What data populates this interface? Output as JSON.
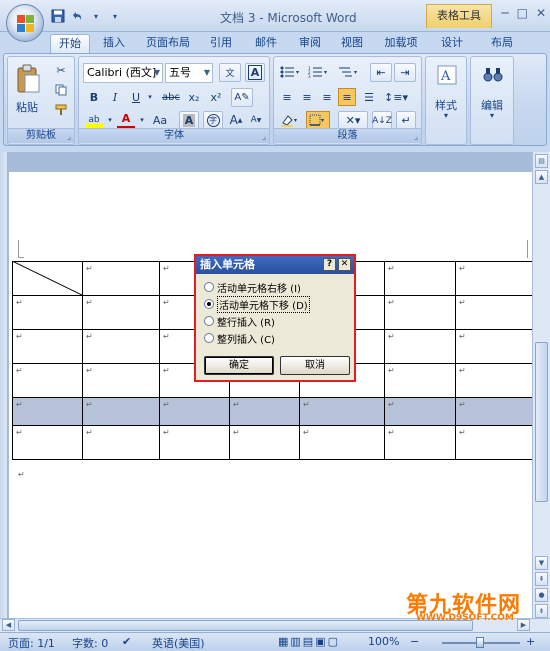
{
  "window": {
    "title": "文档 3 - Microsoft Word",
    "context_tab": "表格工具",
    "controls": [
      "─",
      "□",
      "✕"
    ]
  },
  "quick_access": {
    "save": "save-icon",
    "undo": "undo-icon",
    "customize": "▾"
  },
  "tabs": [
    "开始",
    "插入",
    "页面布局",
    "引用",
    "邮件",
    "审阅",
    "视图",
    "加载项",
    "设计",
    "布局"
  ],
  "active_tab": "开始",
  "ribbon": {
    "clipboard": {
      "paste": "粘贴",
      "label": "剪贴板"
    },
    "font": {
      "name": "Calibri (西文]",
      "size": "五号",
      "label": "字体",
      "bold": "B",
      "italic": "I",
      "underline": "U",
      "strike": "abc",
      "sub": "x₂",
      "sup": "x²",
      "font_color": "A",
      "case": "Aa",
      "grow": "A",
      "shrink": "A",
      "highlight": "ab"
    },
    "paragraph": {
      "label": "段落"
    },
    "styles": {
      "label": "样式"
    },
    "editing": {
      "label": "编辑"
    }
  },
  "table": {
    "cell_mark": "↵",
    "rows": 6,
    "cols": 7,
    "selected_row": 4
  },
  "dialog": {
    "title": "插入单元格",
    "help": "?",
    "close": "✕",
    "options": [
      {
        "label": "活动单元格右移 (I)",
        "checked": false
      },
      {
        "label": "活动单元格下移 (D)",
        "checked": true
      },
      {
        "label": "整行插入 (R)",
        "checked": false
      },
      {
        "label": "整列插入 (C)",
        "checked": false
      }
    ],
    "ok": "确定",
    "cancel": "取消"
  },
  "status": {
    "page": "页面: 1/1",
    "words": "字数: 0",
    "language": "英语(美国)",
    "zoom": "100%",
    "zoom_minus": "−",
    "zoom_plus": "+"
  },
  "watermark": {
    "main": "第九软件网",
    "sub": "WWW.D9SOFT.COM"
  }
}
